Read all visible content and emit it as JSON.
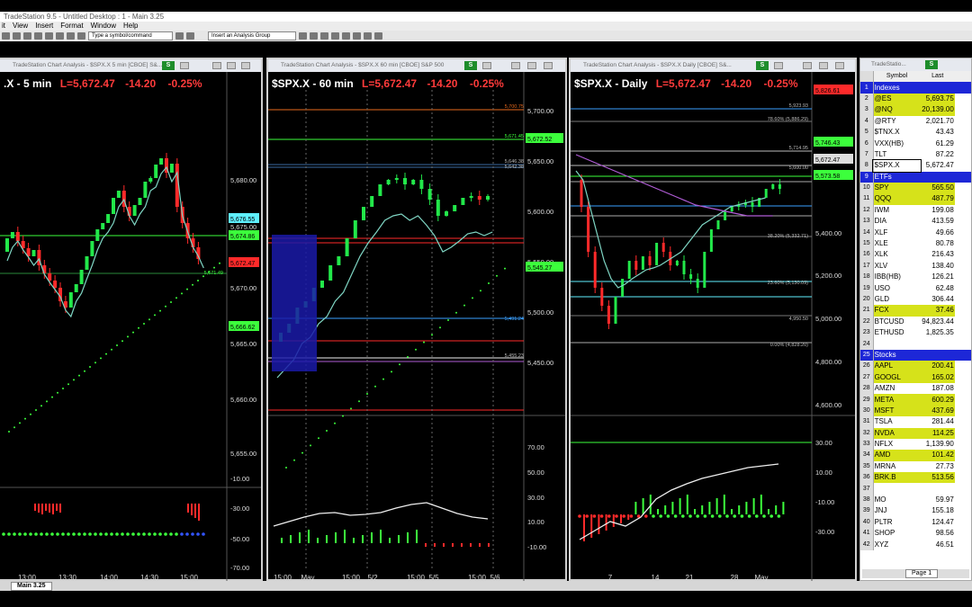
{
  "app": {
    "title": "TradeStation 9.5 - Untitled Desktop : 1 - Main 3.25",
    "menu": [
      "it",
      "View",
      "Insert",
      "Format",
      "Window",
      "Help"
    ],
    "symbol_box_placeholder": "Type a symbol/command",
    "analysis_group": "Insert an Analysis Group"
  },
  "windows": [
    {
      "title": "TradeStation Chart Analysis - $SPX.X 5 min [CBOE] S&...",
      "symbol": ".X - 5 min",
      "last": "L=5,672.47",
      "change": "-14.20",
      "pct": "-0.25%",
      "price_axis": [
        "5,680.00",
        "5,675.00",
        "5,670.00",
        "5,665.00",
        "5,660.00",
        "5,655.00"
      ],
      "ind_axis": [
        "-10.00",
        "-30.00",
        "-50.00",
        "-70.00"
      ],
      "time_axis": [
        "13:00",
        "13:30",
        "14:00",
        "14:30",
        "15:00"
      ],
      "tags": [
        "5,676.55",
        "5,674.86",
        "5,672.47",
        "5,666.62"
      ],
      "small_labels": [
        "5,671.49"
      ]
    },
    {
      "title": "TradeStation Chart Analysis - $SPX.X 60 min [CBOE] S&P 500",
      "symbol": "$SPX.X - 60 min",
      "last": "L=5,672.47",
      "change": "-14.20",
      "pct": "-0.25%",
      "price_axis": [
        "5,700.00",
        "5,650.00",
        "5,600.00",
        "5,550.00",
        "5,500.00",
        "5,450.00"
      ],
      "ind_axis": [
        "70.00",
        "50.00",
        "30.00",
        "10.00",
        "-10.00"
      ],
      "time_axis": [
        "15:00",
        "May",
        "15:00",
        "5/2",
        "15:00",
        "5/5",
        "15:00",
        "5/6"
      ],
      "tags": [
        "5,672.52",
        "5,545.27"
      ],
      "small_labels": [
        "5,700.75",
        "5,671.45",
        "5,646.38",
        "5,642.38",
        "5,491.24",
        "5,455.23"
      ]
    },
    {
      "title": "TradeStation Chart Analysis - $SPX.X Daily [CBOE] S&...",
      "symbol": "$SPX.X - Daily",
      "last": "L=5,672.47",
      "change": "-14.20",
      "pct": "-0.25%",
      "price_axis": [
        "5,400.00",
        "5,200.00",
        "5,000.00",
        "4,800.00",
        "4,600.00"
      ],
      "ind_axis": [
        "30.00",
        "10.00",
        "-10.00",
        "-30.00"
      ],
      "time_axis": [
        "7",
        "14",
        "21",
        "28",
        "May"
      ],
      "tags": [
        "5,826.61",
        "5,746.43",
        "5,672.47",
        "5,573.58"
      ],
      "small_labels": [
        "5,923.93",
        "78.60% (5,886.29)",
        "5,714.95",
        "5,600.00",
        "38.20% (5,332.71)",
        "23.60% (5,130.09)",
        "4,950.50",
        "0.00% (4,828.20)"
      ]
    }
  ],
  "grid": {
    "title": "TradeStatio...",
    "headers": [
      "Symbol",
      "Last"
    ],
    "rows": [
      {
        "n": "1",
        "sym": "Indexes",
        "last": "",
        "section": true
      },
      {
        "n": "2",
        "sym": "@ES",
        "last": "5,693.75",
        "hl": true
      },
      {
        "n": "3",
        "sym": "@NQ",
        "last": "20,139.00",
        "hl": true
      },
      {
        "n": "4",
        "sym": "@RTY",
        "last": "2,021.70"
      },
      {
        "n": "5",
        "sym": "$TNX.X",
        "last": "43.43"
      },
      {
        "n": "6",
        "sym": "VXX(HB)",
        "last": "61.29"
      },
      {
        "n": "7",
        "sym": "TLT",
        "last": "87.22"
      },
      {
        "n": "8",
        "sym": "$SPX.X",
        "last": "5,672.47",
        "sel": true
      },
      {
        "n": "9",
        "sym": "ETFs",
        "last": "",
        "section": true
      },
      {
        "n": "10",
        "sym": "SPY",
        "last": "565.50",
        "hl": true
      },
      {
        "n": "11",
        "sym": "QQQ",
        "last": "487.79",
        "hl": true
      },
      {
        "n": "12",
        "sym": "IWM",
        "last": "199.08"
      },
      {
        "n": "13",
        "sym": "DIA",
        "last": "413.59"
      },
      {
        "n": "14",
        "sym": "XLF",
        "last": "49.66"
      },
      {
        "n": "15",
        "sym": "XLE",
        "last": "80.78"
      },
      {
        "n": "16",
        "sym": "XLK",
        "last": "216.43"
      },
      {
        "n": "17",
        "sym": "XLV",
        "last": "138.40"
      },
      {
        "n": "18",
        "sym": "IBB(HB)",
        "last": "126.21"
      },
      {
        "n": "19",
        "sym": "USO",
        "last": "62.48"
      },
      {
        "n": "20",
        "sym": "GLD",
        "last": "306.44"
      },
      {
        "n": "21",
        "sym": "FCX",
        "last": "37.46",
        "hl": true
      },
      {
        "n": "22",
        "sym": "BTCUSD",
        "last": "94,823.44"
      },
      {
        "n": "23",
        "sym": "ETHUSD",
        "last": "1,825.35"
      },
      {
        "n": "24",
        "sym": "",
        "last": ""
      },
      {
        "n": "25",
        "sym": "Stocks",
        "last": "",
        "section": true
      },
      {
        "n": "26",
        "sym": "AAPL",
        "last": "200.41",
        "hl": true
      },
      {
        "n": "27",
        "sym": "GOOGL",
        "last": "165.02",
        "hl": true
      },
      {
        "n": "28",
        "sym": "AMZN",
        "last": "187.08"
      },
      {
        "n": "29",
        "sym": "META",
        "last": "600.29",
        "hl": true
      },
      {
        "n": "30",
        "sym": "MSFT",
        "last": "437.69",
        "hl": true
      },
      {
        "n": "31",
        "sym": "TSLA",
        "last": "281.44"
      },
      {
        "n": "32",
        "sym": "NVDA",
        "last": "114.25",
        "hl": true
      },
      {
        "n": "33",
        "sym": "NFLX",
        "last": "1,139.90"
      },
      {
        "n": "34",
        "sym": "AMD",
        "last": "101.42",
        "hl": true
      },
      {
        "n": "35",
        "sym": "MRNA",
        "last": "27.73"
      },
      {
        "n": "36",
        "sym": "BRK.B",
        "last": "513.56",
        "hl": true
      },
      {
        "n": "37",
        "sym": "",
        "last": ""
      },
      {
        "n": "38",
        "sym": "MO",
        "last": "59.97"
      },
      {
        "n": "39",
        "sym": "JNJ",
        "last": "155.18"
      },
      {
        "n": "40",
        "sym": "PLTR",
        "last": "124.47"
      },
      {
        "n": "41",
        "sym": "SHOP",
        "last": "98.56"
      },
      {
        "n": "42",
        "sym": "XYZ",
        "last": "46.51"
      }
    ],
    "page_tab": "Page 1"
  },
  "desktop_tab": "Main 3.25",
  "colors": {
    "up": "#22e84a",
    "down": "#ff2a2a",
    "grid_blue": "#1d27d7",
    "tag_green": "#39ff3a"
  }
}
